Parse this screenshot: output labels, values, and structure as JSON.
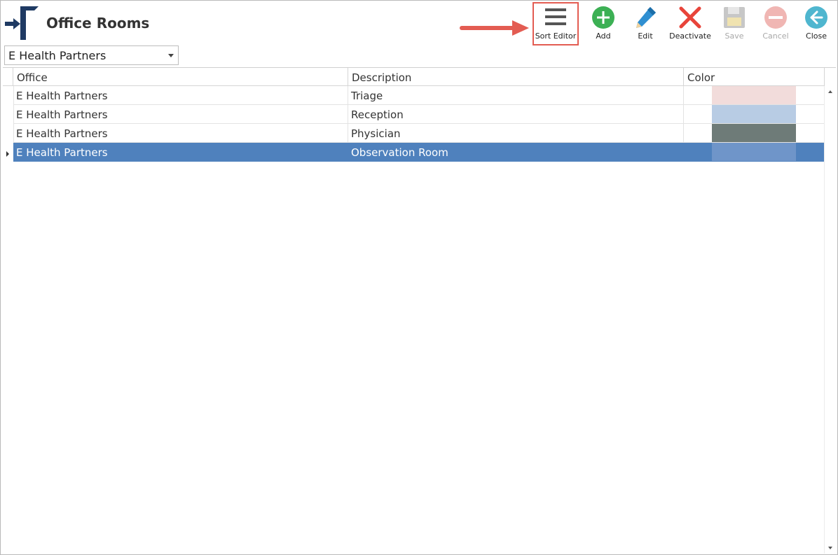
{
  "header": {
    "title": "Office Rooms"
  },
  "toolbar": {
    "sort_editor": "Sort Editor",
    "add": "Add",
    "edit": "Edit",
    "deactivate": "Deactivate",
    "save": "Save",
    "cancel": "Cancel",
    "close": "Close"
  },
  "office_select": {
    "value": "E Health Partners"
  },
  "grid": {
    "columns": [
      "Office",
      "Description",
      "Color"
    ],
    "rows": [
      {
        "office": "E Health Partners",
        "description": "Triage",
        "color": "#f2dcdb"
      },
      {
        "office": "E Health Partners",
        "description": "Reception",
        "color": "#b8cce4"
      },
      {
        "office": "E Health Partners",
        "description": "Physician",
        "color": "#6e7b78"
      },
      {
        "office": "E Health Partners",
        "description": "Observation Room",
        "color": "#6f95c9",
        "selected": true
      }
    ]
  },
  "colors": {
    "selection": "#4f81bd",
    "highlight": "#e35c52",
    "add": "#3cb054",
    "edit": "#2f8fd1",
    "deactivate": "#e8443a",
    "close": "#4fb6cf"
  }
}
